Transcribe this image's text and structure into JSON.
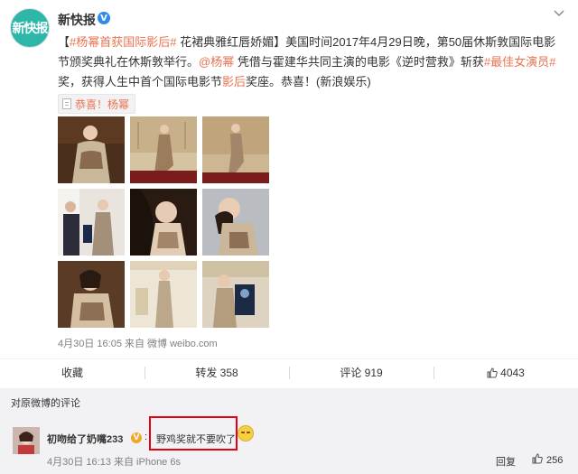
{
  "post": {
    "author": "新快报",
    "avatar_text": "新快报",
    "verified_mark": "V",
    "text_segments": [
      {
        "text": "【",
        "style": "normal"
      },
      {
        "text": "#杨幂首获国际影后#",
        "style": "hash"
      },
      {
        "text": " 花裙典雅红唇娇媚】美国时间2017年4月29日晚，第50届休斯敦国际电影节颁奖典礼在休斯敦举行。",
        "style": "normal"
      },
      {
        "text": "@杨幂",
        "style": "hl"
      },
      {
        "text": " 凭借与霍建华共同主演的电影《逆时营救》斩获",
        "style": "normal"
      },
      {
        "text": "#最佳女演员#",
        "style": "hash"
      },
      {
        "text": "奖，获得人生中首个国际电影节",
        "style": "normal"
      },
      {
        "text": "影后",
        "style": "hl"
      },
      {
        "text": "奖座。恭喜！(新浪娱乐)",
        "style": "normal"
      }
    ],
    "tag_chip": "恭喜！杨幂",
    "meta": "4月30日 16:05 来自 微博 weibo.com"
  },
  "actions": {
    "favorite": "收藏",
    "repost": "转发 358",
    "comment": "评论 919",
    "like": "4043"
  },
  "comments": {
    "title": "对原微博的评论",
    "items": [
      {
        "user": "初吻给了奶嘴233",
        "vip_mark": "V",
        "colon": ":",
        "text": "野鸡奖就不要吹了",
        "meta": "4月30日 16:13 来自 iPhone 6s",
        "reply": "回复",
        "likes": "256"
      }
    ]
  },
  "colors": {
    "accent": "#eb7350",
    "highlight_box": "#e60012",
    "avatar_bg": "#2eb7a9",
    "verified": "#2d8ce8"
  },
  "icons": [
    "menu-chevron-icon",
    "verified-icon",
    "document-icon",
    "thumbs-up-icon",
    "vip-icon",
    "smiley-emoji-icon"
  ]
}
